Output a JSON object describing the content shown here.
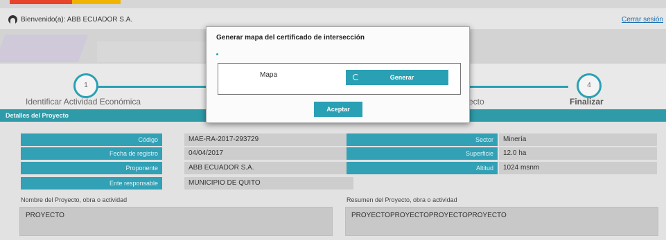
{
  "header": {
    "welcome": "Bienvenido(a): ABB ECUADOR S.A.",
    "logout": "Cerrar sesión"
  },
  "wizard": {
    "step1_number": "1",
    "step1_label": "Identificar Actividad Económica",
    "step3_label_partial": "ecto",
    "step4_number": "4",
    "step4_label": "Finalizar"
  },
  "details": {
    "section_title": "Detalles del Proyecto",
    "left_fields": [
      {
        "label": "Código",
        "value": "MAE-RA-2017-293729"
      },
      {
        "label": "Fecha de registro",
        "value": "04/04/2017"
      },
      {
        "label": "Proponente",
        "value": "ABB ECUADOR S.A."
      },
      {
        "label": "Ente responsable",
        "value": "MUNICIPIO DE QUITO"
      }
    ],
    "right_fields": [
      {
        "label": "Sector",
        "value": "Minería"
      },
      {
        "label": "Superficie",
        "value": "12.0 ha"
      },
      {
        "label": "Altitud",
        "value": "1024 msnm"
      }
    ],
    "name_label": "Nombre del Proyecto, obra o actividad",
    "name_value": "PROYECTO",
    "summary_label": "Resumen del Proyecto, obra o actividad",
    "summary_value": "PROYECTOPROYECTOPROYECTOPROYECTO"
  },
  "modal": {
    "title": "Generar mapa del certificado de intersección",
    "map_label": "Mapa",
    "generate_label": "Generar",
    "accept_label": "Aceptar"
  },
  "colors": {
    "accent": "#2aa0b4",
    "section_bar": "#2f9aa8"
  }
}
